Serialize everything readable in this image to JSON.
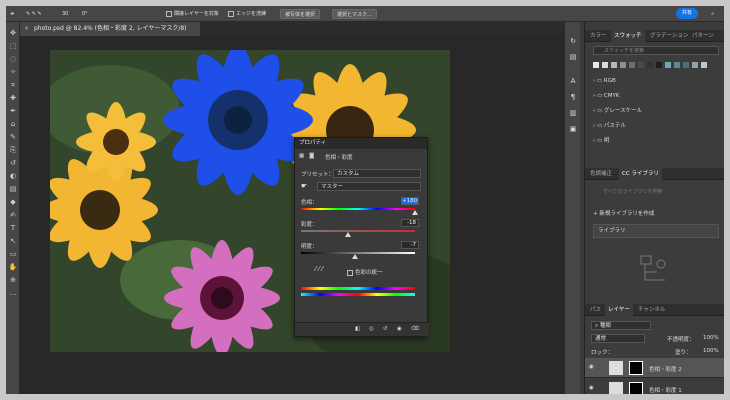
{
  "options_bar": {
    "contiguous": "隣接レイヤーを対象",
    "edge": "エッジを洗練",
    "select_subject": "被写体を選択",
    "select_mask": "選択とマスク...",
    "share": "共有",
    "brush_size": "30"
  },
  "document": {
    "tab_title": "photo.psd @ 82.4% (色相・彩度 2, レイヤーマスク/8)"
  },
  "properties": {
    "panel_title": "プロパティ",
    "adjustment_name": "色相・彩度",
    "preset_label": "プリセット：",
    "preset_value": "カスタム",
    "channel_value": "マスター",
    "hue_label": "色相：",
    "hue_value": "+180",
    "saturation_label": "彩度：",
    "saturation_value": "-18",
    "lightness_label": "明度：",
    "lightness_value": "-7",
    "colorize_label": "色彩の統一",
    "hue_pos": 1.0,
    "saturation_pos": 0.41,
    "lightness_pos": 0.47
  },
  "right_panel": {
    "swatch_tabs": [
      "カラー",
      "スウォッチ",
      "グラデーション",
      "パターン"
    ],
    "swatch_search": "スウォッチを検索",
    "folders": [
      "RGB",
      "CMYK",
      "グレースケール",
      "パステル",
      "明"
    ],
    "adjust_tabs": [
      "色調補正",
      "CC ライブラリ"
    ],
    "lib_search": "すべてのライブラリを検索",
    "create_lib": "新規ライブラリを作成",
    "library_name": "ライブラリ",
    "layer_tabs": [
      "パス",
      "レイヤー",
      "チャンネル"
    ],
    "kind": "種類",
    "blend": "通常",
    "opacity_label": "不透明度：",
    "opacity": "100%",
    "lock_label": "ロック：",
    "fill_label": "塗り：",
    "fill": "100%",
    "layers": [
      "色相・彩度 2",
      "色相・彩度 1"
    ]
  },
  "colors": {
    "accent": "#1473e6",
    "swatches": [
      "#e8e8e8",
      "#d9d9d9",
      "#b8b8b8",
      "#909090",
      "#6d6d6d",
      "#4a4a4a",
      "#333333",
      "#1e1e1e",
      "#6fa8b3",
      "#5c8a93",
      "#4d6f78",
      "#93a2a8",
      "#c0c8cc"
    ]
  }
}
